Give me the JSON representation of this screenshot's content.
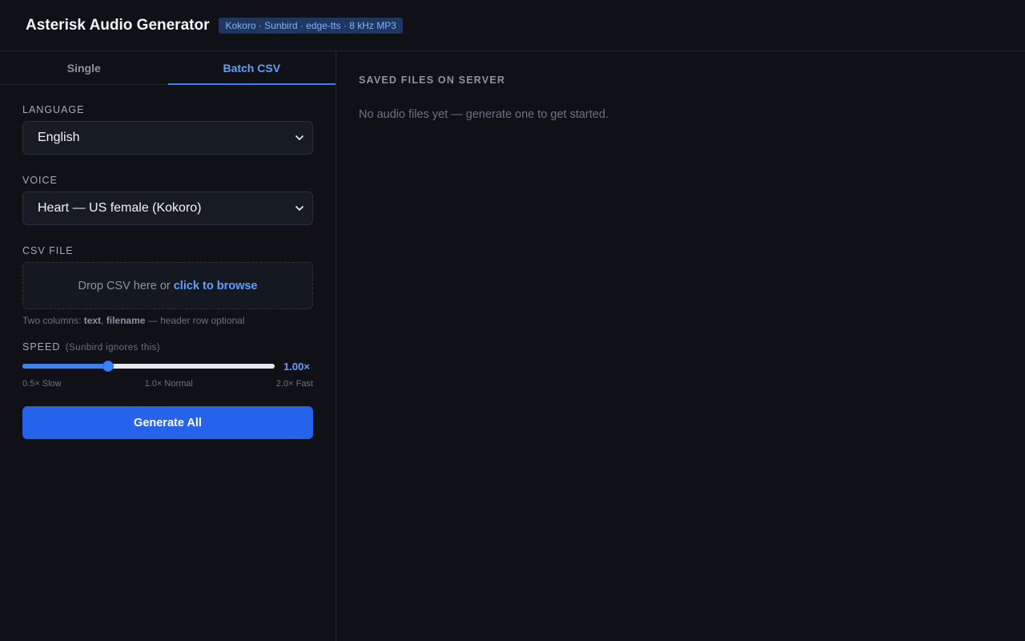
{
  "header": {
    "title": "Asterisk Audio Generator",
    "badge": "Kokoro · Sunbird · edge-tts · 8 kHz MP3"
  },
  "tabs": [
    {
      "label": "Single",
      "active": false
    },
    {
      "label": "Batch CSV",
      "active": true
    }
  ],
  "form": {
    "language": {
      "label": "Language",
      "value": "English"
    },
    "voice": {
      "label": "Voice",
      "value": "Heart — US female (Kokoro)"
    },
    "csv": {
      "label": "CSV File",
      "drop_text": "Drop CSV here or",
      "browse_text": "click to browse",
      "hint_prefix": "Two columns:",
      "hint_col1": "text",
      "hint_sep": ",",
      "hint_col2": "filename",
      "hint_suffix": "— header row optional"
    },
    "speed": {
      "label": "Speed",
      "note": "(Sunbird ignores this)",
      "value_text": "1.00×",
      "value": 1.0,
      "min": 0.5,
      "max": 2.0,
      "tick_min": "0.5× Slow",
      "tick_mid": "1.0× Normal",
      "tick_max": "2.0× Fast"
    },
    "generate_label": "Generate All"
  },
  "files": {
    "title": "Saved Files On Server",
    "empty_text": "No audio files yet — generate one to get started."
  },
  "colors": {
    "background": "#0f1116",
    "accent": "#3b82f6",
    "button": "#2563eb"
  }
}
